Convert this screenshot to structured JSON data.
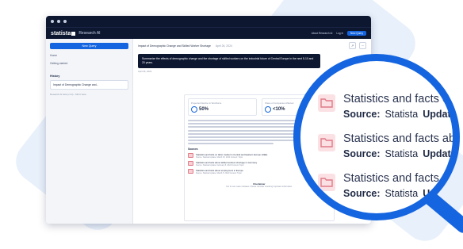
{
  "app": {
    "brand_name": "statista",
    "brand_sub": "Research AI",
    "top_nav": [
      "About Research AI",
      "Log in"
    ],
    "new_query_label": "New Query"
  },
  "sidebar": {
    "new_query_label": "New Query",
    "items": [
      "Home",
      "Getting started"
    ],
    "history_title": "History",
    "history_items": [
      "Impact of Demographic Change and..."
    ],
    "note": "Research AI beta (v1.0) - Still in beta"
  },
  "main": {
    "title": "Impact of Demographic Change and Skilled Worker Shortage",
    "date": "April 26, 2024",
    "query": "Summarize the effects of demographic change and the shortage of skilled workers on the industrial future of Central Europe in the next 5-10 and 20 years.",
    "query_date": "April 26, 2024",
    "stats": [
      {
        "label": "Projected Decline in Workforce",
        "value": "50%"
      },
      {
        "label": "Share of Companies Affected",
        "value": "<10%"
      }
    ],
    "sources_title": "Sources",
    "sources": [
      {
        "title": "Statistics and facts on labor market in Central and Eastern Europe (CEE)",
        "meta": "Source: Statista Update: March 15, 2024 Content: Topic"
      },
      {
        "title": "Statistics and facts about skilled workers shortage in Germany",
        "meta": "Source: Statista Update: February 8, 2024 Content: Topic"
      },
      {
        "title": "Statistics and facts about employment in Europe",
        "meta": "Source: Statista Update: March 5, 2024 Content: Topic"
      }
    ],
    "show_all_label": "Show all 7 sources",
    "disclaimer_title": "Disclaimer",
    "disclaimer_text": "Our AI can make mistakes. Please consider checking important information."
  },
  "lens": {
    "rows": [
      {
        "title": "Statistics and facts on l",
        "source_label": "Source:",
        "source_value": "Statista",
        "update_label": "Update:"
      },
      {
        "title": "Statistics and facts about s",
        "source_label": "Source:",
        "source_value": "Statista",
        "update_label": "Update:",
        "extra": "F"
      },
      {
        "title": "Statistics and facts abou",
        "source_label": "Source:",
        "source_value": "Statista",
        "update_label": "Update:"
      }
    ]
  },
  "colors": {
    "accent": "#1565e0",
    "dark": "#0d1730",
    "folder_bg": "#fbe1e4",
    "folder_stroke": "#e07b88"
  },
  "icons": {
    "folder": "folder-icon",
    "search": "magnifier-icon"
  }
}
